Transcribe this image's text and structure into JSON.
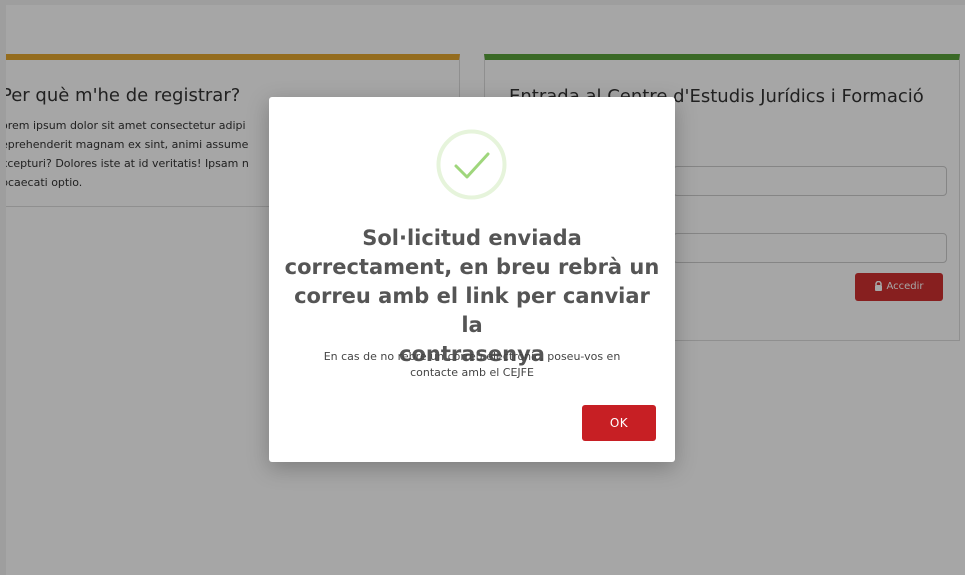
{
  "left_panel": {
    "title": "Per què m'he de registrar?",
    "paragraph": [
      "orem ipsum dolor sit amet consectetur adipi",
      "eprehenderit magnam ex sint, animi assume",
      "xcepturi? Dolores iste at id veritatis! Ipsam n",
      "bcaecati optio."
    ]
  },
  "right_panel": {
    "title": "Entrada al Centre d'Estudis Jurídics i Formació",
    "access_button": "Accedir"
  },
  "modal": {
    "icon": "success-check-icon",
    "title_lines": [
      "Sol·licitud enviada",
      "correctament, en breu rebrà un",
      "correu amb el link per canviar la",
      "contrasenya"
    ],
    "message_lines": [
      "En cas de no rebre un correu electrònic, poseu-vos en",
      "contacte amb el CEJFE"
    ],
    "ok_label": "OK"
  },
  "colors": {
    "left_accent": "#e3a72f",
    "right_accent": "#5aa13b",
    "success_check": "#9fd67c",
    "primary_red": "#c71f24"
  }
}
